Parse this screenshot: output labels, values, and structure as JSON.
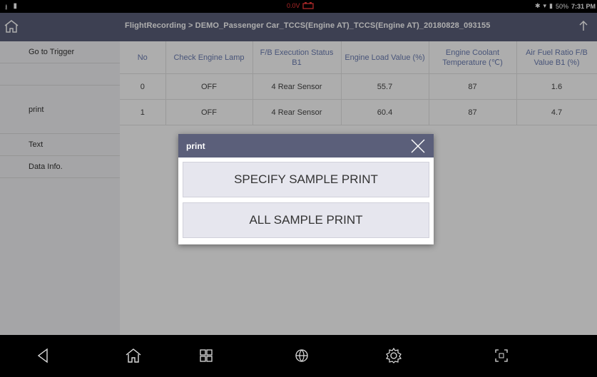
{
  "status_bar": {
    "voltage": "0.0V",
    "battery_percent": "50%",
    "time": "7:31 PM"
  },
  "header": {
    "breadcrumb": "FlightRecording > DEMO_Passenger Car_TCCS(Engine AT)_TCCS(Engine AT)_20180828_093155"
  },
  "sidebar": {
    "items": [
      {
        "label": "Go to Trigger"
      },
      {
        "label": ""
      },
      {
        "label": "print"
      },
      {
        "label": "Text"
      },
      {
        "label": "Data Info."
      }
    ]
  },
  "table": {
    "columns": [
      "No",
      "Check Engine Lamp",
      "F/B Execution Status B1",
      "Engine Load Value (%)",
      "Engine Coolant Temperature (℃)",
      "Air Fuel Ratio F/B Value B1 (%)"
    ],
    "rows": [
      [
        "0",
        "OFF",
        "4 Rear Sensor",
        "55.7",
        "87",
        "1.6"
      ],
      [
        "1",
        "OFF",
        "4 Rear Sensor",
        "60.4",
        "87",
        "4.7"
      ]
    ]
  },
  "dialog": {
    "title": "print",
    "buttons": [
      "SPECIFY SAMPLE PRINT",
      "ALL SAMPLE PRINT"
    ]
  },
  "colors": {
    "header_bg": "#5b5f7a",
    "column_header_text": "#6b7db3",
    "voltage_text": "#ff3b3b"
  },
  "icons": [
    "home-icon",
    "upload-icon",
    "close-icon",
    "back-icon",
    "menu-grid-icon",
    "globe-icon",
    "settings-icon",
    "screenshot-icon"
  ]
}
